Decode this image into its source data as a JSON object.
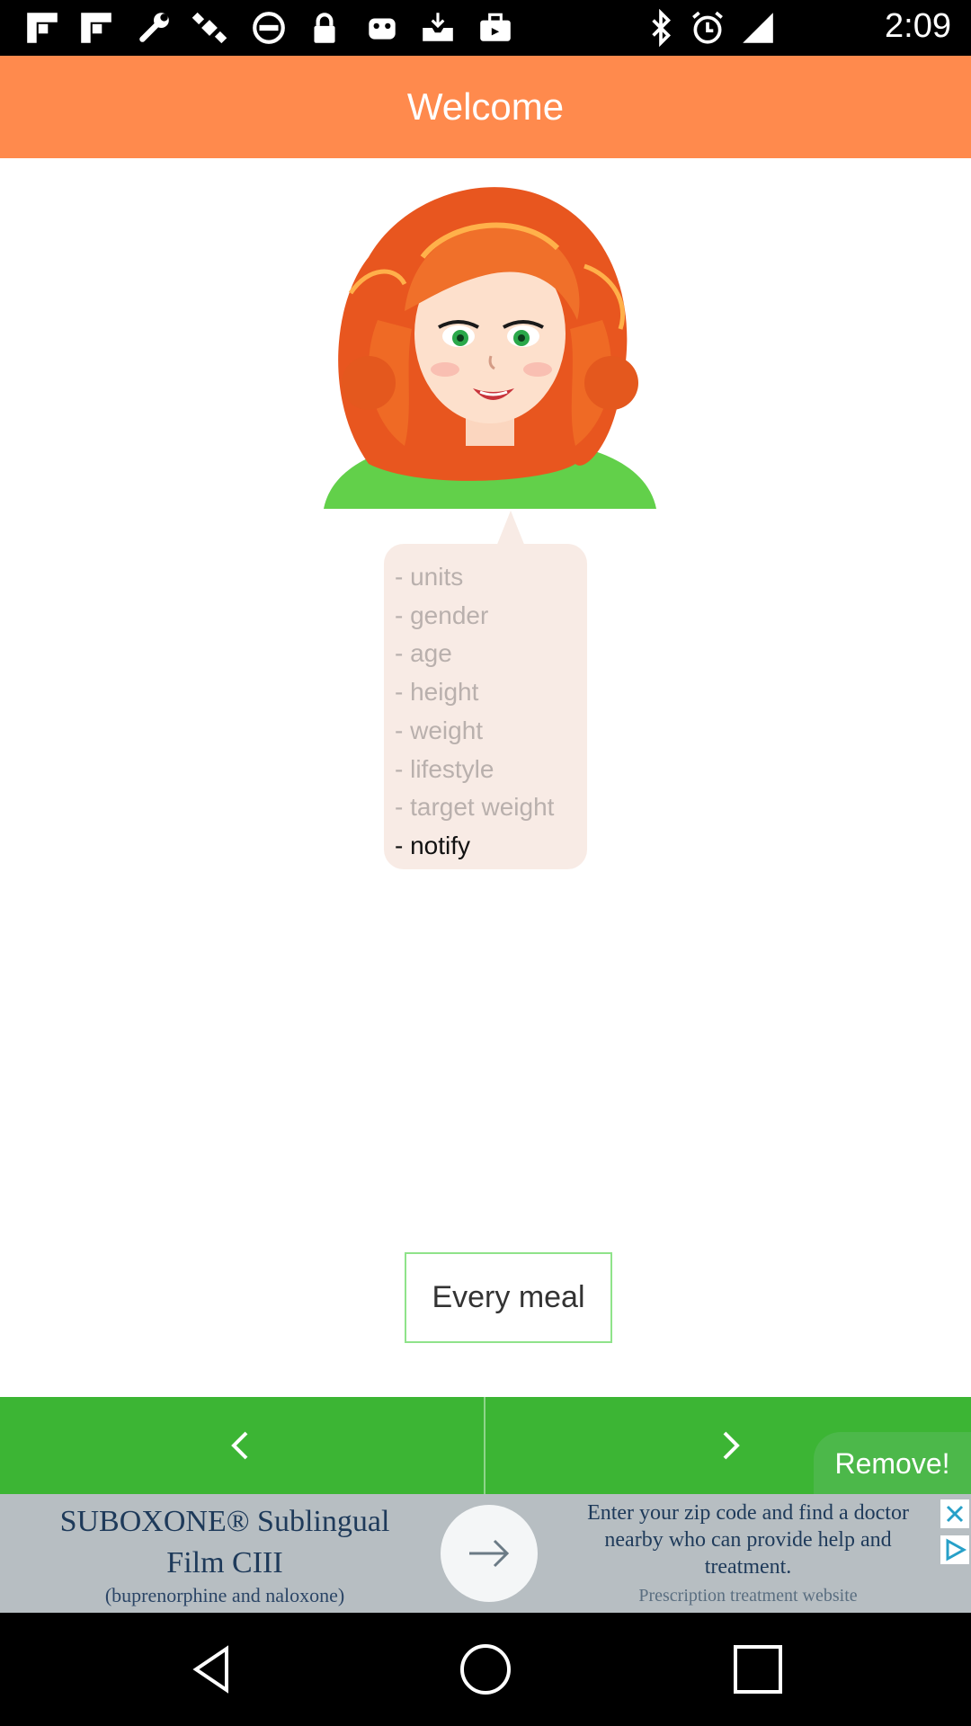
{
  "status_bar": {
    "time": "2:09",
    "left_icons": [
      "flipboard-icon",
      "flipboard-icon",
      "wrench-icon",
      "satellite-icon",
      "blocked-icon",
      "lock-icon",
      "android-icon",
      "inbox-icon",
      "briefcase-icon"
    ],
    "right_icons": [
      "bluetooth-icon",
      "alarm-icon",
      "signal-icon"
    ]
  },
  "header": {
    "title": "Welcome"
  },
  "bubble": {
    "items": [
      {
        "label": "- units"
      },
      {
        "label": "- gender"
      },
      {
        "label": "- age"
      },
      {
        "label": "- height"
      },
      {
        "label": "- weight"
      },
      {
        "label": "- lifestyle"
      },
      {
        "label": "- target weight"
      },
      {
        "label": "- notify"
      }
    ],
    "active_index": 7
  },
  "meal_button": {
    "label": "Every meal"
  },
  "nav": {
    "prev_icon": "chevron-left-icon",
    "next_icon": "chevron-right-icon",
    "remove_label": "Remove!"
  },
  "ad": {
    "title_line1": "SUBOXONE® Sublingual",
    "title_line2": "Film CIII",
    "subtitle": "(buprenorphine and naloxone)",
    "desc_line1": "Enter your zip code and find a doctor",
    "desc_line2": "nearby who can provide help and",
    "desc_line3": "treatment.",
    "site": "Prescription treatment website"
  },
  "colors": {
    "header": "#ff8a4d",
    "nav_green": "#3cb534",
    "bubble_bg": "#f8ebe5",
    "ad_bg": "#b7bec2"
  }
}
